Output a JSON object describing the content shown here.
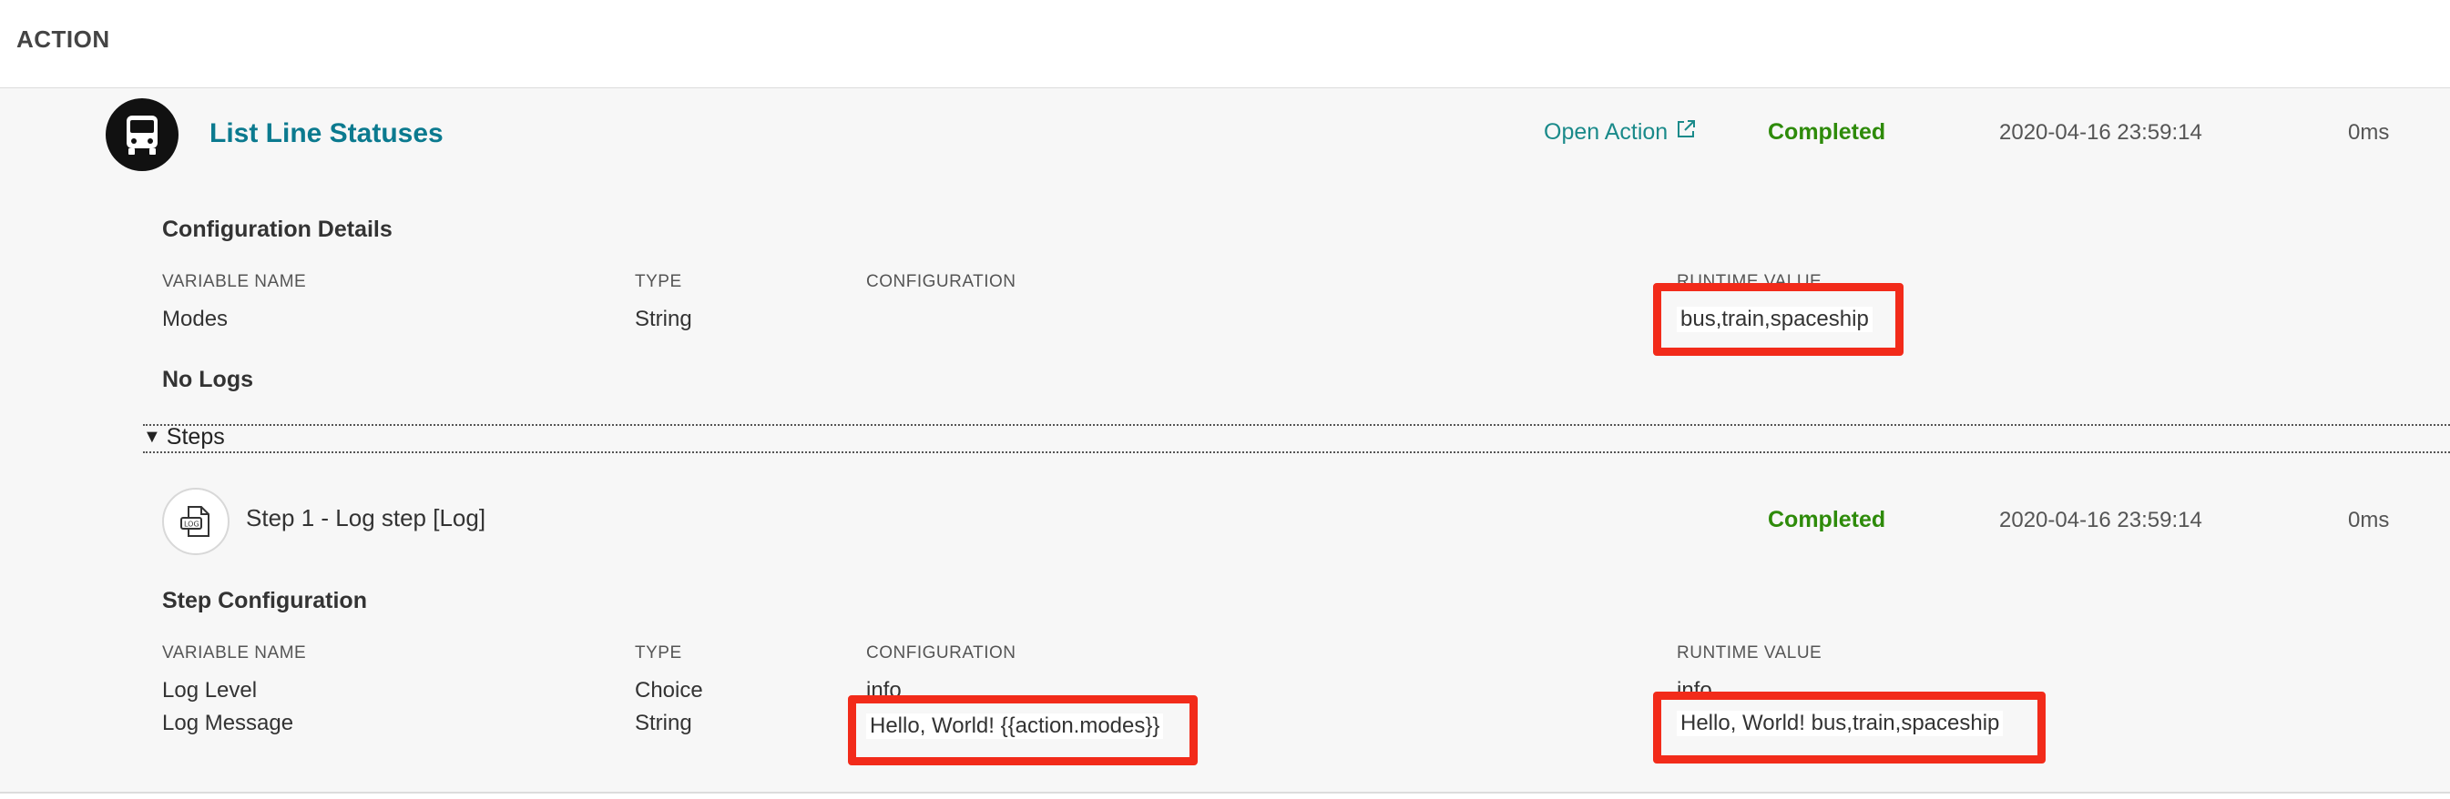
{
  "section": {
    "title": "ACTION"
  },
  "action": {
    "icon": "bus-icon",
    "title": "List Line Statuses",
    "open_action_label": "Open Action",
    "status": "Completed",
    "timestamp": "2020-04-16 23:59:14",
    "duration": "0ms",
    "config_heading": "Configuration Details",
    "columns": [
      "VARIABLE NAME",
      "TYPE",
      "CONFIGURATION",
      "RUNTIME VALUE"
    ],
    "rows": [
      {
        "name": "Modes",
        "type": "String",
        "configuration": "",
        "runtime": "bus,train,spaceship"
      }
    ],
    "logs_label": "No Logs"
  },
  "steps": {
    "label": "Steps",
    "items": [
      {
        "icon": "log-file-icon",
        "title": "Step 1 - Log step [Log]",
        "status": "Completed",
        "timestamp": "2020-04-16 23:59:14",
        "duration": "0ms",
        "config_heading": "Step Configuration",
        "columns": [
          "VARIABLE NAME",
          "TYPE",
          "CONFIGURATION",
          "RUNTIME VALUE"
        ],
        "rows": [
          {
            "name": "Log Level",
            "type": "Choice",
            "configuration": "info",
            "runtime": "info"
          },
          {
            "name": "Log Message",
            "type": "String",
            "configuration": "Hello,  World! {{action.modes}}",
            "runtime": "Hello,  World! bus,train,spaceship"
          }
        ]
      }
    ]
  },
  "colors": {
    "accent": "#0b7a8f",
    "status_ok": "#2e8b0a",
    "highlight": "#f22b1a"
  }
}
